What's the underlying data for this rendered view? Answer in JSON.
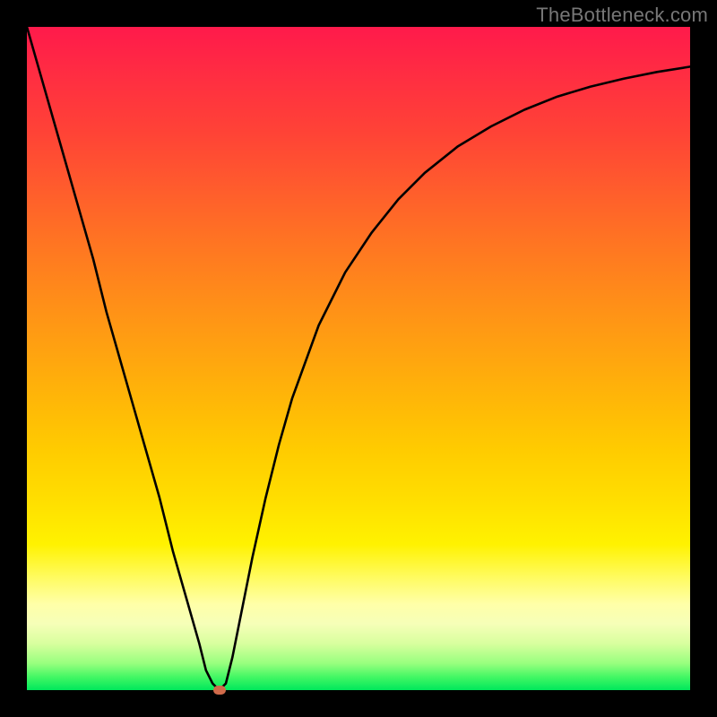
{
  "watermark": "TheBottleneck.com",
  "chart_data": {
    "type": "line",
    "title": "",
    "xlabel": "",
    "ylabel": "",
    "xlim": [
      0,
      100
    ],
    "ylim": [
      0,
      100
    ],
    "grid": false,
    "legend": false,
    "series": [
      {
        "name": "bottleneck-curve",
        "x": [
          0,
          2,
          4,
          6,
          8,
          10,
          12,
          14,
          16,
          18,
          20,
          22,
          24,
          26,
          27,
          28,
          29,
          30,
          31,
          32,
          33,
          34,
          36,
          38,
          40,
          44,
          48,
          52,
          56,
          60,
          65,
          70,
          75,
          80,
          85,
          90,
          95,
          100
        ],
        "values": [
          100,
          93,
          86,
          79,
          72,
          65,
          57,
          50,
          43,
          36,
          29,
          21,
          14,
          7,
          3,
          1,
          0,
          1,
          5,
          10,
          15,
          20,
          29,
          37,
          44,
          55,
          63,
          69,
          74,
          78,
          82,
          85,
          87.5,
          89.5,
          91,
          92.2,
          93.2,
          94
        ]
      }
    ],
    "annotations": [
      {
        "type": "min-marker",
        "x": 29,
        "y": 0,
        "color": "#d06a4a"
      }
    ],
    "background_gradient": {
      "direction": "vertical",
      "stops": [
        {
          "pos": 0,
          "color": "#ff1a4b"
        },
        {
          "pos": 40,
          "color": "#ff8a1a"
        },
        {
          "pos": 72,
          "color": "#ffe000"
        },
        {
          "pos": 90,
          "color": "#f6ffb8"
        },
        {
          "pos": 100,
          "color": "#00e85c"
        }
      ]
    }
  }
}
